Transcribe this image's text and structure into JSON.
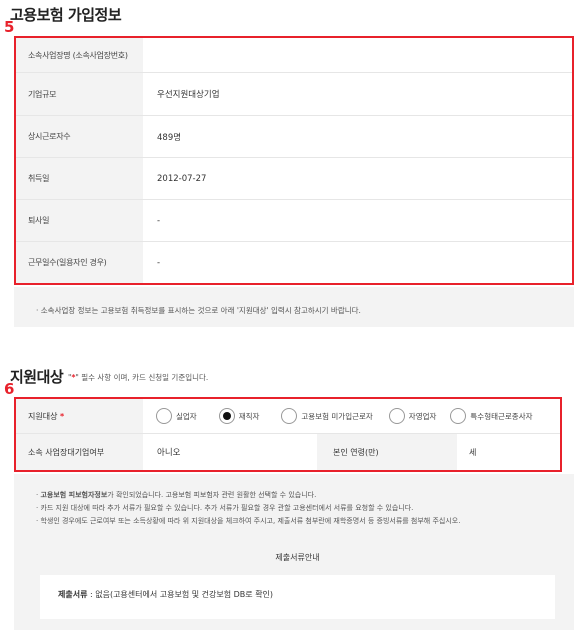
{
  "section5": {
    "title": "고용보험 가입정보",
    "badge": "5",
    "rows": [
      {
        "label": "소속사업장명 (소속사업장번호)",
        "value": ""
      },
      {
        "label": "기업규모",
        "value": "우선지원대상기업"
      },
      {
        "label": "상시근로자수",
        "value": "489명"
      },
      {
        "label": "취득일",
        "value": "2012-07-27"
      },
      {
        "label": "퇴사일",
        "value": "-"
      },
      {
        "label": "근무일수(일용자인 경우)",
        "value": "-"
      }
    ],
    "note": "· 소속사업장 정보는 고용보험 취득정보를 표시하는 것으로 아래 '지원대상' 입력시 참고하시기 바랍니다."
  },
  "section6": {
    "title": "지원대상",
    "badge": "6",
    "required_note_prefix": "\"",
    "required_star": "*",
    "required_note_suffix": "\" 필수 사항 이며, 카드 신청일 기준입니다.",
    "target_label": "지원대상",
    "target_star": "*",
    "options": [
      {
        "label": "실업자",
        "selected": false
      },
      {
        "label": "재직자",
        "selected": true
      },
      {
        "label": "고용보험 미가입근로자",
        "selected": false
      },
      {
        "label": "자영업자",
        "selected": false
      },
      {
        "label": "특수형태근로종사자",
        "selected": false
      }
    ],
    "affiliation_label": "소속 사업장대기업여부",
    "affiliation_value": "아니오",
    "age_label": "본인 연령(만)",
    "age_value": "세"
  },
  "info": {
    "line1_bold": "고용보험 피보험자정보",
    "line1_rest": "가 확인되었습니다. 고용보험 피보험자 관련 원활한 선택할 수 있습니다.",
    "line2": "· 카드 지원 대상에 따라 추가 서류가 필요할 수 있습니다. 추가 서류가 필요할 경우 관할 고용센터에서 서류를 요청할 수 있습니다.",
    "line3": "· 학생인 경우에도 근로여부 또는 소득상황에 따라 위 지원대상을 체크하여 주시고, 제출서류 첨부란에 재학증명서 등 증빙서류를 첨부해 주십시오.",
    "doc_title": "제출서류안내",
    "doc_bold": "제출서류",
    "doc_rest": " : 없음(고용센터에서 고용보험 및 건강보험 DB로 확인)"
  }
}
